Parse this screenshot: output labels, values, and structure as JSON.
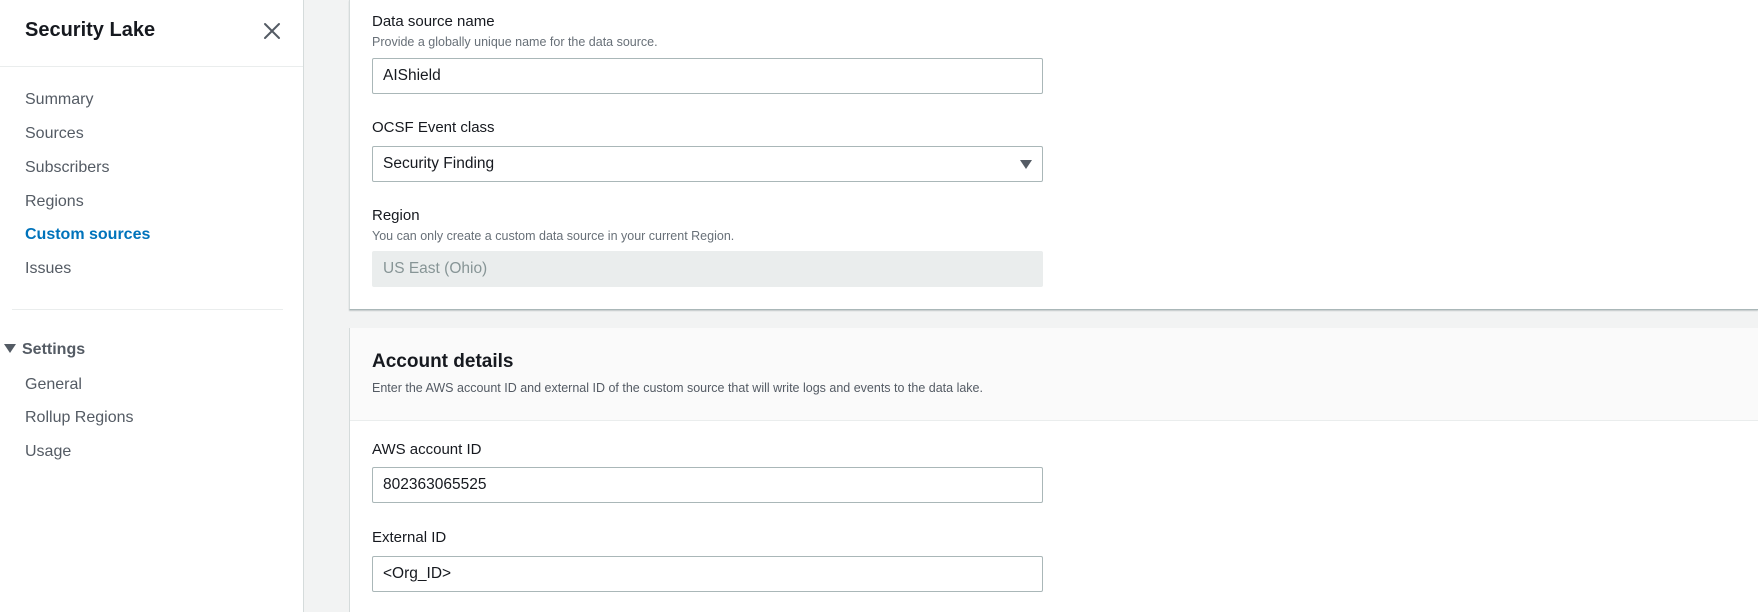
{
  "sidebar": {
    "title": "Security Lake",
    "close_icon": "close-icon",
    "items": [
      {
        "label": "Summary",
        "active": false
      },
      {
        "label": "Sources",
        "active": false
      },
      {
        "label": "Subscribers",
        "active": false
      },
      {
        "label": "Regions",
        "active": false
      },
      {
        "label": "Custom sources",
        "active": true
      },
      {
        "label": "Issues",
        "active": false
      }
    ],
    "settings": {
      "label": "Settings",
      "expanded": true,
      "items": [
        {
          "label": "General"
        },
        {
          "label": "Rollup Regions"
        },
        {
          "label": "Usage"
        }
      ]
    }
  },
  "data_source": {
    "name_label": "Data source name",
    "name_description": "Provide a globally unique name for the data source.",
    "name_value": "AIShield",
    "event_class_label": "OCSF Event class",
    "event_class_value": "Security Finding",
    "region_label": "Region",
    "region_description": "You can only create a custom data source in your current Region.",
    "region_value": "US East (Ohio)"
  },
  "account_details": {
    "title": "Account details",
    "description": "Enter the AWS account ID and external ID of the custom source that will write logs and events to the data lake.",
    "account_id_label": "AWS account ID",
    "account_id_value": "802363065525",
    "external_id_label": "External ID",
    "external_id_value": "<Org_ID>"
  },
  "colors": {
    "accent": "#0073bb",
    "text": "#16191f",
    "muted": "#545b64",
    "border": "#aab7b8"
  }
}
